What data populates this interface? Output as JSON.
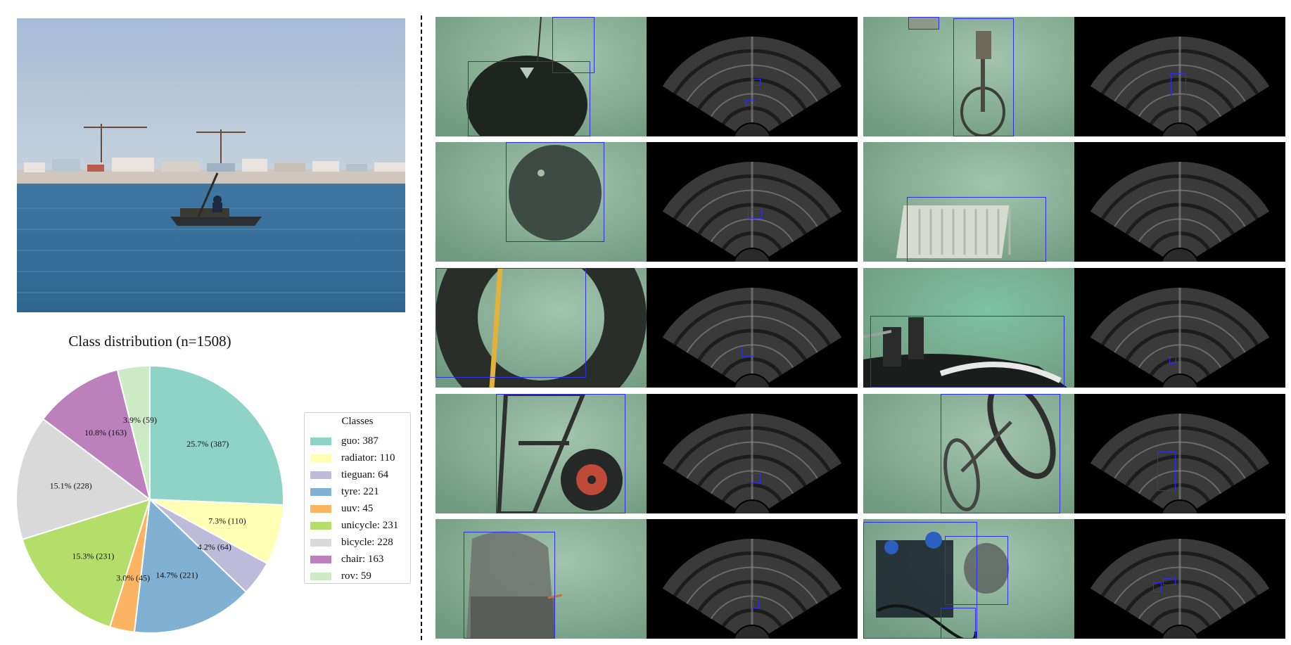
{
  "chart_data": {
    "type": "pie",
    "title": "Class distribution (n=1508)",
    "total": 1508,
    "categories": [
      "guo",
      "radiator",
      "tieguan",
      "tyre",
      "uuv",
      "unicycle",
      "bicycle",
      "chair",
      "rov"
    ],
    "values": [
      387,
      110,
      64,
      221,
      45,
      231,
      228,
      163,
      59
    ],
    "slice_labels": [
      "25.7% (387)",
      "7.3% (110)",
      "4.2% (64)",
      "14.7% (221)",
      "3.0% (45)",
      "15.3% (231)",
      "15.1% (228)",
      "10.8% (163)",
      "3.9% (59)"
    ],
    "colors": [
      "#8fd3c7",
      "#ffffb3",
      "#bebada",
      "#80b1d3",
      "#fdb462",
      "#b3de69",
      "#d9d9d9",
      "#bc80bd",
      "#ccebc5"
    ],
    "start_angle_deg": 90,
    "direction": "clockwise",
    "legend": {
      "title": "Classes",
      "position": "right",
      "entries": [
        "guo: 387",
        "radiator: 110",
        "tieguan: 64",
        "tyre: 221",
        "uuv: 45",
        "unicycle: 231",
        "bicycle: 228",
        "chair: 163",
        "rov: 59"
      ]
    }
  },
  "colors": {
    "bbox": "#2f2fe6",
    "sky": "#a8bfd6",
    "sea": "#3d6f98",
    "underwater": "#8eb49c"
  },
  "samples": [
    {
      "position": "row-1-left",
      "object": "guo"
    },
    {
      "position": "row-1-right",
      "object": "unicycle"
    },
    {
      "position": "row-2-left",
      "object": "guo"
    },
    {
      "position": "row-2-right",
      "object": "radiator"
    },
    {
      "position": "row-3-left",
      "object": "tyre"
    },
    {
      "position": "row-3-right",
      "object": "uuv"
    },
    {
      "position": "row-4-left",
      "object": "chair"
    },
    {
      "position": "row-4-right",
      "object": "bicycle"
    },
    {
      "position": "row-5-left",
      "object": "tieguan"
    },
    {
      "position": "row-5-right",
      "object": "rov"
    }
  ]
}
